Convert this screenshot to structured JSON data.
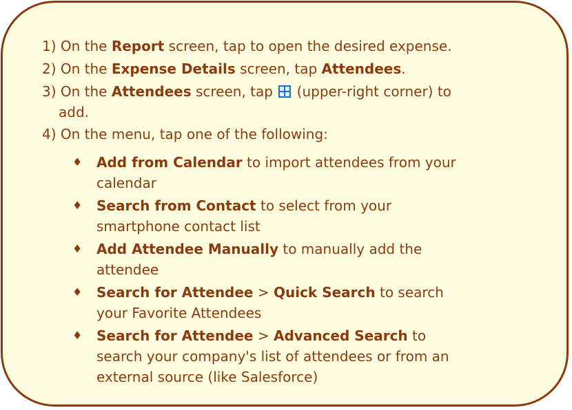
{
  "steps": [
    {
      "num": "1)",
      "pre": " On the ",
      "b1": "Report",
      "post": " screen, tap to open the desired expense."
    },
    {
      "num": "2)",
      "pre": " On the ",
      "b1": "Expense Details",
      "mid": " screen, tap ",
      "b2": "Attendees",
      "post": "."
    },
    {
      "num": "3)",
      "pre": " On the ",
      "b1": "Attendees",
      "mid": " screen, tap ",
      "icon": "plus-icon",
      "post": " (upper-right corner) to",
      "cont": "add."
    },
    {
      "num": "4)",
      "text": " On the menu, tap one of the following:"
    }
  ],
  "options": [
    {
      "bold": "Add from Calendar",
      "text": " to import attendees from your",
      "cont": "calendar"
    },
    {
      "bold": "Search from Contact",
      "text": " to select from your",
      "cont": "smartphone contact list"
    },
    {
      "bold": "Add Attendee Manually",
      "text": " to manually add the",
      "cont": "attendee"
    },
    {
      "bold": "Search for Attendee",
      "sep": " > ",
      "bold2": "Quick Search",
      "text": " to search",
      "cont": "your Favorite Attendees"
    },
    {
      "bold": "Search for Attendee",
      "sep": " > ",
      "bold2": "Advanced Search",
      "text": " to",
      "cont": "search your company's list of attendees or from an",
      "cont2": "external source (like Salesforce)"
    }
  ],
  "bullet_glyph": "♦",
  "colors": {
    "text": "#8b3a0e",
    "background": "#fffde0",
    "border": "#8b3a0e",
    "icon": "#1a73c8"
  }
}
